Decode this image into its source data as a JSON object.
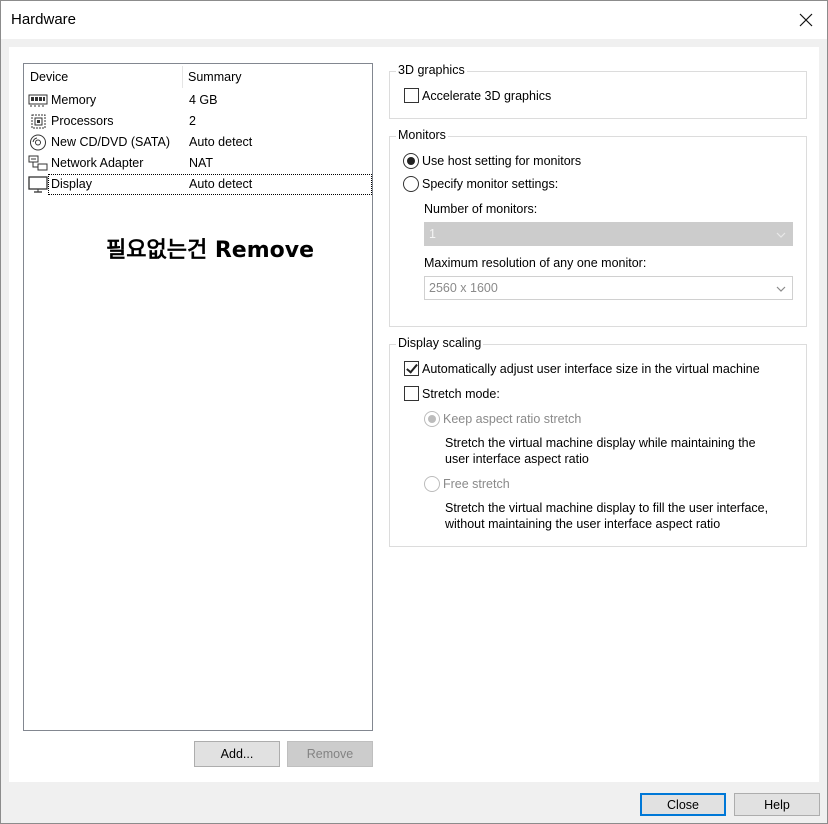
{
  "window": {
    "title": "Hardware",
    "close_icon": "close-icon"
  },
  "device_list": {
    "columns": [
      "Device",
      "Summary"
    ],
    "rows": [
      {
        "name": "Memory",
        "summary": "4 GB",
        "icon": "memory-icon"
      },
      {
        "name": "Processors",
        "summary": "2",
        "icon": "processor-icon"
      },
      {
        "name": "New CD/DVD (SATA)",
        "summary": "Auto detect",
        "icon": "cd-dvd-icon"
      },
      {
        "name": "Network Adapter",
        "summary": "NAT",
        "icon": "network-adapter-icon"
      },
      {
        "name": "Display",
        "summary": "Auto detect",
        "icon": "display-icon"
      }
    ],
    "selected": "Display",
    "annotation": "필요없는건 Remove"
  },
  "buttons": {
    "add": "Add...",
    "remove": "Remove",
    "close": "Close",
    "help": "Help"
  },
  "graphics": {
    "legend": "3D graphics",
    "accelerate_label": "Accelerate 3D graphics",
    "accelerate_checked": false
  },
  "monitors": {
    "legend": "Monitors",
    "use_host_label": "Use host setting for monitors",
    "specify_label": "Specify monitor settings:",
    "selected_option": "Use host setting for monitors",
    "number_label": "Number of monitors:",
    "number_value": "1",
    "max_res_label": "Maximum resolution of any one monitor:",
    "max_res_value": "2560 x 1600"
  },
  "display_scaling": {
    "legend": "Display scaling",
    "auto_adjust_label": "Automatically adjust user interface size in the virtual machine",
    "auto_adjust_checked": true,
    "stretch_label": "Stretch mode:",
    "stretch_checked": false,
    "keep_aspect_label": "Keep aspect ratio stretch",
    "keep_aspect_desc_1": "Stretch the virtual machine display while maintaining the",
    "keep_aspect_desc_2": "user interface aspect ratio",
    "free_stretch_label": "Free stretch",
    "free_stretch_desc_1": "Stretch the virtual machine display to fill the user interface,",
    "free_stretch_desc_2": "without maintaining the user interface aspect ratio",
    "selected_stretch": "Keep aspect ratio stretch"
  }
}
